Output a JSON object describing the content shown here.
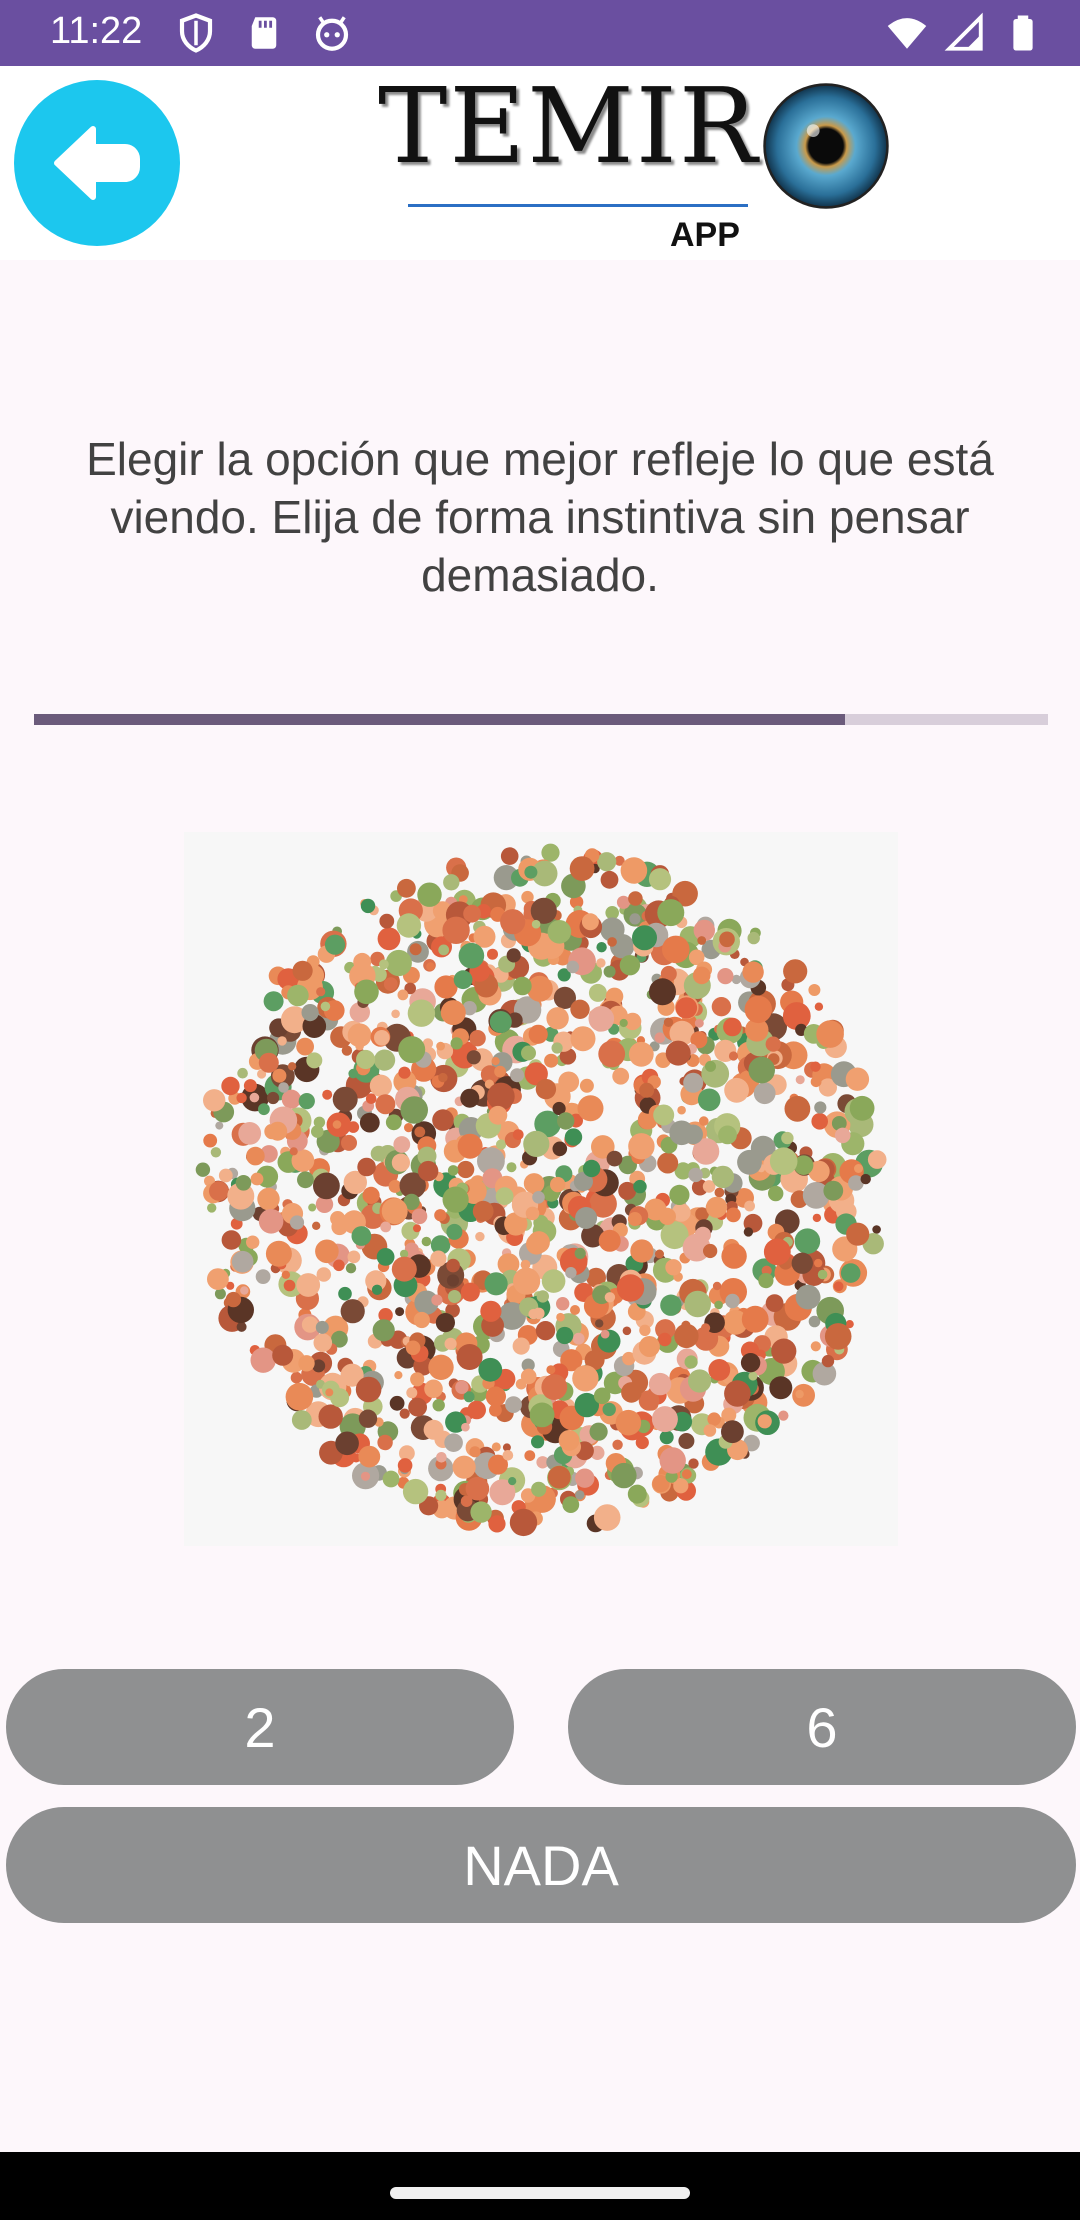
{
  "status_bar": {
    "time": "11:22",
    "left_icons": [
      "shield-icon",
      "sd-card-icon",
      "android-face-icon"
    ],
    "right_icons": [
      "wifi-icon",
      "signal-icon",
      "battery-icon"
    ],
    "background_color": "#6a4fa0"
  },
  "header": {
    "back_icon": "arrow-left-icon",
    "back_color": "#1cc7ee",
    "logo_text": "TEMIR",
    "logo_subtitle": "APP"
  },
  "instructions": "Elegir la opción que mejor refleje lo que está viendo. Elija de forma instintiva sin pensar demasiado.",
  "progress": {
    "fraction": 0.8,
    "fill_color": "#6b5b7b",
    "track_color": "#d8ceda"
  },
  "answers": {
    "option_a": "2",
    "option_b": "6",
    "option_none": "NADA",
    "button_color": "#8f9091"
  },
  "colors": {
    "background": "#fdf7fb"
  }
}
